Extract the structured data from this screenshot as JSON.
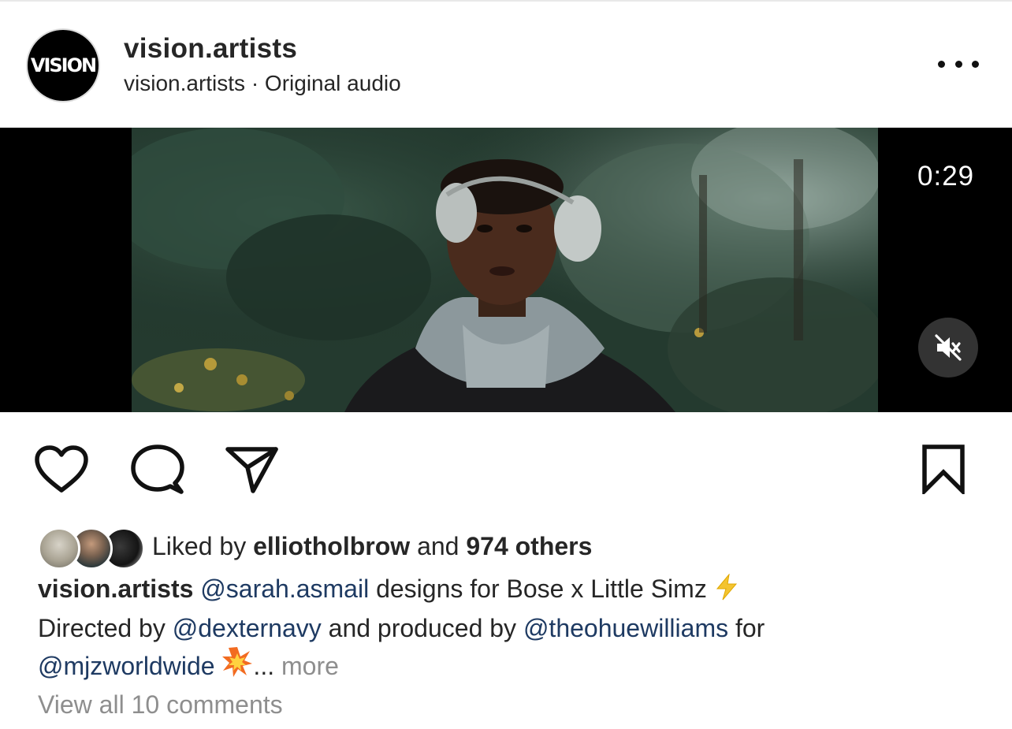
{
  "header": {
    "avatar_text": "VISION",
    "username": "vision.artists",
    "audio_line": "vision.artists · Original audio",
    "more_icon": "ellipsis-icon"
  },
  "video": {
    "timer": "0:29",
    "mute_icon": "speaker-muted-icon"
  },
  "actions": {
    "like_icon": "heart-icon",
    "comment_icon": "comment-bubble-icon",
    "share_icon": "paper-plane-icon",
    "save_icon": "bookmark-icon"
  },
  "likes": {
    "prefix": "Liked by ",
    "user": "elliotholbrow",
    "middle": " and ",
    "others": "974 others"
  },
  "caption": {
    "author": "vision.artists",
    "mention1": "@sarah.asmail",
    "text1": " designs for Bose x Little Simz ",
    "emoji1": "⚡",
    "text2": "Directed by ",
    "mention2": "@dexternavy",
    "text3": " and produced by ",
    "mention3": "@theohuewilliams",
    "text4": " for ",
    "mention4": "@mjzworldwide",
    "emoji2": "💥",
    "ellipsis": "... ",
    "more": "more"
  },
  "comments": {
    "view_all": "View all 10 comments"
  }
}
